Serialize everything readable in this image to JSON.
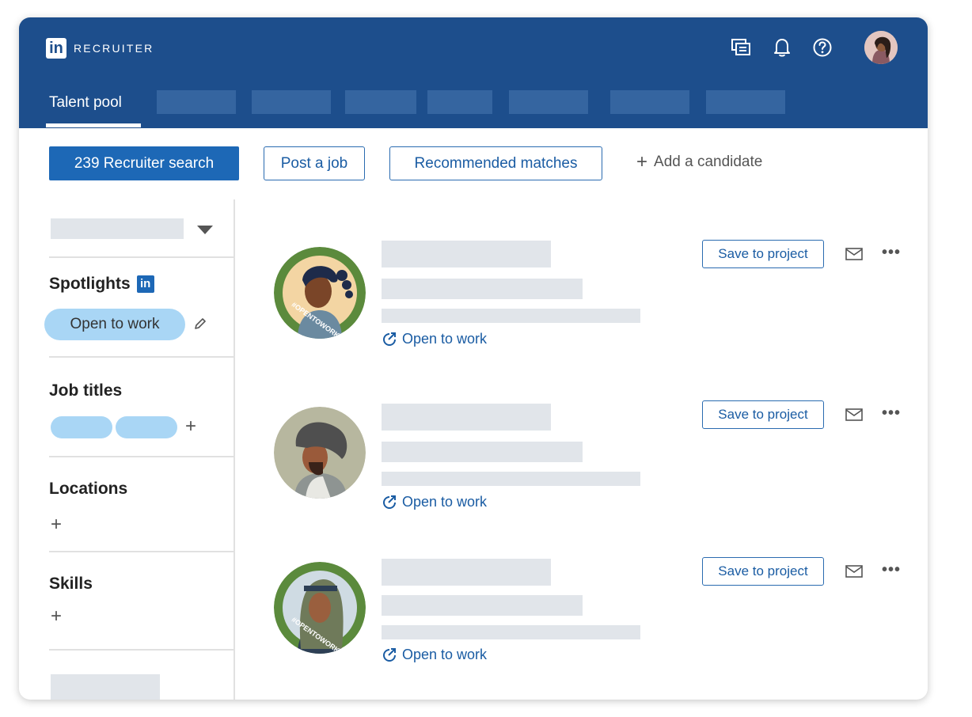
{
  "header": {
    "logo_mark": "in",
    "logo_text": "RECRUITER",
    "icons": [
      "chat-icon",
      "bell-icon",
      "help-icon",
      "avatar"
    ],
    "active_tab": "Talent pool",
    "brand_color": "#1d4e8c"
  },
  "toolbar": {
    "recruiter_search": "239 Recruiter search",
    "post_job": "Post a job",
    "recommended": "Recommended matches",
    "add_candidate": "Add a candidate",
    "add_icon": "+"
  },
  "sidebar": {
    "spotlights_title": "Spotlights",
    "spotlights_badge": "in",
    "open_to_work_chip": "Open to work",
    "job_titles_title": "Job titles",
    "locations_title": "Locations",
    "skills_title": "Skills",
    "add_symbol": "+"
  },
  "candidates": [
    {
      "status": "Open to work",
      "save_label": "Save to project",
      "more": "•••"
    },
    {
      "status": "Open to work",
      "save_label": "Save to project",
      "more": "•••"
    },
    {
      "status": "Open to work",
      "save_label": "Save to project",
      "more": "•••"
    }
  ],
  "colors": {
    "accent": "#1d68b6",
    "chip": "#a9d6f5",
    "placeholder": "#e1e5ea"
  }
}
